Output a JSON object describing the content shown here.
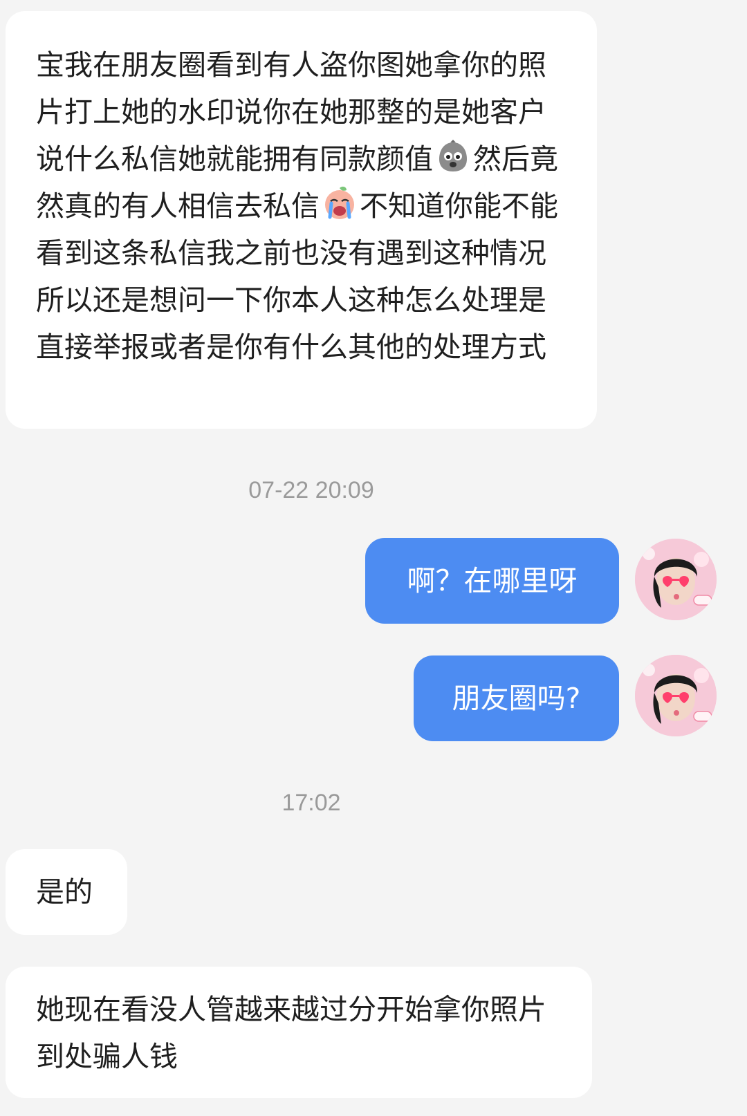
{
  "messages": {
    "m1_part1": "宝我在朋友圈看到有人盗你图她拿你的照片打上她的水印说你在她那整的是她客户说什么私信她就能拥有同款颜值",
    "m1_part2": "然后竟然真的有人相信去私信",
    "m1_part3": "不知道你能不能看到这条私信我之前也没有遇到这种情况所以还是想问一下你本人这种怎么处理是直接举报或者是你有什么其他的处理方式",
    "time1": "07-22 20:09",
    "m2": "啊？在哪里呀",
    "m3": "朋友圈吗?",
    "time2": "17:02",
    "m4": "是的",
    "m5": "她现在看没人管越来越过分开始拿你照片到处骗人钱"
  },
  "emoji": {
    "e1": "scared-face-emoji",
    "e2": "crying-face-emoji"
  },
  "colors": {
    "background": "#f4f4f4",
    "incoming_bubble": "#ffffff",
    "outgoing_bubble": "#4d8cf2",
    "timestamp_text": "#9a9a9a"
  }
}
